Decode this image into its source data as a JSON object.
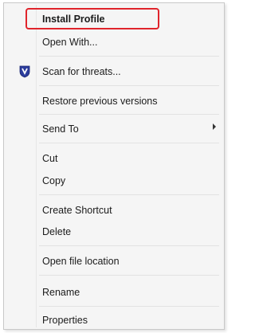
{
  "menu": {
    "items": [
      {
        "label": "Install Profile"
      },
      {
        "label": "Open With..."
      },
      {
        "label": "Scan for threats..."
      },
      {
        "label": "Restore previous versions"
      },
      {
        "label": "Send To"
      },
      {
        "label": "Cut"
      },
      {
        "label": "Copy"
      },
      {
        "label": "Create Shortcut"
      },
      {
        "label": "Delete"
      },
      {
        "label": "Open file location"
      },
      {
        "label": "Rename"
      },
      {
        "label": "Properties"
      }
    ],
    "scan_icon": "shield-icon",
    "submenu_icon": "arrow-right-icon",
    "highlight_color": "#e0242b"
  }
}
